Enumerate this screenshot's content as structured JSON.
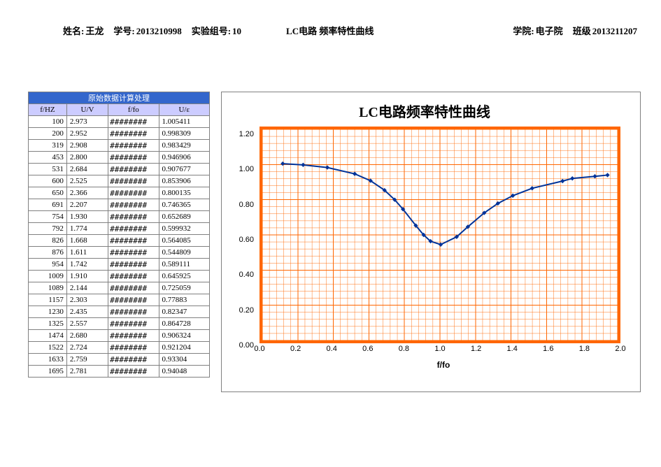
{
  "header": {
    "name_label": "姓名:",
    "name": "王龙",
    "sid_label": "学号:",
    "sid": "2013210998",
    "group_label": "实验组号:",
    "group": "10",
    "title": "LC电路 频率特性曲线",
    "college_label": "学院:",
    "college": "电子院",
    "class_label": "班级",
    "class": "2013211207"
  },
  "table": {
    "section": "原始数据计算处理",
    "cols": [
      "f/HZ",
      "U/V",
      "f/fo",
      "U/ε"
    ],
    "overflow": "########",
    "rows": [
      {
        "fhz": "100",
        "uv": "2.973",
        "ue": "1.005411"
      },
      {
        "fhz": "200",
        "uv": "2.952",
        "ue": "0.998309"
      },
      {
        "fhz": "319",
        "uv": "2.908",
        "ue": "0.983429"
      },
      {
        "fhz": "453",
        "uv": "2.800",
        "ue": "0.946906"
      },
      {
        "fhz": "531",
        "uv": "2.684",
        "ue": "0.907677"
      },
      {
        "fhz": "600",
        "uv": "2.525",
        "ue": "0.853906"
      },
      {
        "fhz": "650",
        "uv": "2.366",
        "ue": "0.800135"
      },
      {
        "fhz": "691",
        "uv": "2.207",
        "ue": "0.746365"
      },
      {
        "fhz": "754",
        "uv": "1.930",
        "ue": "0.652689"
      },
      {
        "fhz": "792",
        "uv": "1.774",
        "ue": "0.599932"
      },
      {
        "fhz": "826",
        "uv": "1.668",
        "ue": "0.564085"
      },
      {
        "fhz": "876",
        "uv": "1.611",
        "ue": "0.544809"
      },
      {
        "fhz": "954",
        "uv": "1.742",
        "ue": "0.589111"
      },
      {
        "fhz": "1009",
        "uv": "1.910",
        "ue": "0.645925"
      },
      {
        "fhz": "1089",
        "uv": "2.144",
        "ue": "0.725059"
      },
      {
        "fhz": "1157",
        "uv": "2.303",
        "ue": "0.77883"
      },
      {
        "fhz": "1230",
        "uv": "2.435",
        "ue": "0.82347"
      },
      {
        "fhz": "1325",
        "uv": "2.557",
        "ue": "0.864728"
      },
      {
        "fhz": "1474",
        "uv": "2.680",
        "ue": "0.906324"
      },
      {
        "fhz": "1522",
        "uv": "2.724",
        "ue": "0.921204"
      },
      {
        "fhz": "1633",
        "uv": "2.759",
        "ue": "0.93304"
      },
      {
        "fhz": "1695",
        "uv": "2.781",
        "ue": "0.94048"
      }
    ]
  },
  "chart": {
    "title": "LC电路频率特性曲线",
    "xlabel": "f/fo",
    "yticks": [
      "0.00",
      "0.20",
      "0.40",
      "0.60",
      "0.80",
      "1.00",
      "1.20"
    ],
    "xticks": [
      "0.0",
      "0.2",
      "0.4",
      "0.6",
      "0.8",
      "1.0",
      "1.2",
      "1.4",
      "1.6",
      "1.8",
      "2.0"
    ]
  },
  "chart_data": {
    "type": "line",
    "title": "LC电路频率特性曲线",
    "xlabel": "f/fo",
    "ylabel": "",
    "xlim": [
      0.0,
      2.0
    ],
    "ylim": [
      0.0,
      1.2
    ],
    "x": [
      0.115,
      0.23,
      0.366,
      0.52,
      0.609,
      0.688,
      0.745,
      0.792,
      0.864,
      0.908,
      0.947,
      1.004,
      1.094,
      1.157,
      1.249,
      1.326,
      1.41,
      1.519,
      1.69,
      1.745,
      1.872,
      1.943
    ],
    "y": [
      1.005,
      0.998,
      0.983,
      0.947,
      0.908,
      0.854,
      0.8,
      0.746,
      0.653,
      0.6,
      0.564,
      0.545,
      0.589,
      0.646,
      0.725,
      0.779,
      0.823,
      0.865,
      0.906,
      0.921,
      0.933,
      0.94
    ],
    "series": [
      {
        "name": "U/ε",
        "color": "#003399"
      }
    ]
  }
}
